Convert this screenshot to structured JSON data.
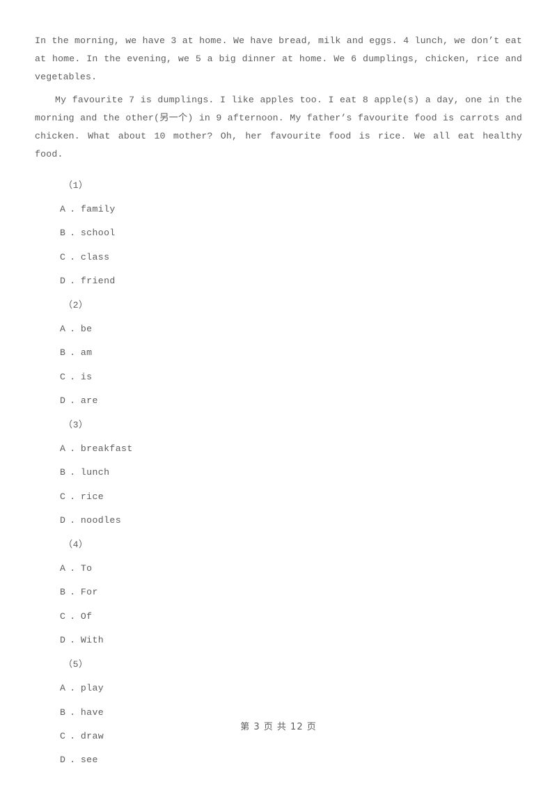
{
  "document": {
    "type": "cloze-test-worksheet",
    "background_color": "#ffffff",
    "text_color": "#5c5c5c"
  },
  "passage": {
    "paragraph_1": "In the morning, we have 3 at home. We have bread, milk and eggs. 4 lunch, we don’t eat at home. In the evening, we 5 a big dinner at home. We 6 dumplings, chicken, rice and vegetables.",
    "paragraph_2_part_1": "My favourite 7 is dumplings. I like apples too. I eat 8 apple(s) a day, one in the morning and the other(",
    "paragraph_2_cn": "另一个",
    "paragraph_2_part_2": ") in 9 afternoon. My father’s favourite food is carrots and chicken. What about 10 mother? Oh, her favourite food is rice. We all eat healthy food."
  },
  "questions": [
    {
      "number": "（1）",
      "options": [
        {
          "letter": "A",
          "sep": ".",
          "text": "family"
        },
        {
          "letter": "B",
          "sep": ".",
          "text": "school"
        },
        {
          "letter": "C",
          "sep": ".",
          "text": "class"
        },
        {
          "letter": "D",
          "sep": ".",
          "text": "friend"
        }
      ]
    },
    {
      "number": "（2）",
      "options": [
        {
          "letter": "A",
          "sep": ".",
          "text": "be"
        },
        {
          "letter": "B",
          "sep": ".",
          "text": "am"
        },
        {
          "letter": "C",
          "sep": ".",
          "text": "is"
        },
        {
          "letter": "D",
          "sep": ".",
          "text": "are"
        }
      ]
    },
    {
      "number": "（3）",
      "options": [
        {
          "letter": "A",
          "sep": ".",
          "text": "breakfast"
        },
        {
          "letter": "B",
          "sep": ".",
          "text": "lunch"
        },
        {
          "letter": "C",
          "sep": ".",
          "text": "rice"
        },
        {
          "letter": "D",
          "sep": ".",
          "text": "noodles"
        }
      ]
    },
    {
      "number": "（4）",
      "options": [
        {
          "letter": "A",
          "sep": ".",
          "text": "To"
        },
        {
          "letter": "B",
          "sep": ".",
          "text": "For"
        },
        {
          "letter": "C",
          "sep": ".",
          "text": "Of"
        },
        {
          "letter": "D",
          "sep": ".",
          "text": "With"
        }
      ]
    },
    {
      "number": "（5）",
      "options": [
        {
          "letter": "A",
          "sep": ".",
          "text": "play"
        },
        {
          "letter": "B",
          "sep": ".",
          "text": "have"
        },
        {
          "letter": "C",
          "sep": ".",
          "text": "draw"
        },
        {
          "letter": "D",
          "sep": ".",
          "text": "see"
        }
      ]
    }
  ],
  "footer": {
    "text": "第 3 页 共 12 页",
    "current_page": "3",
    "total_pages": "12"
  }
}
